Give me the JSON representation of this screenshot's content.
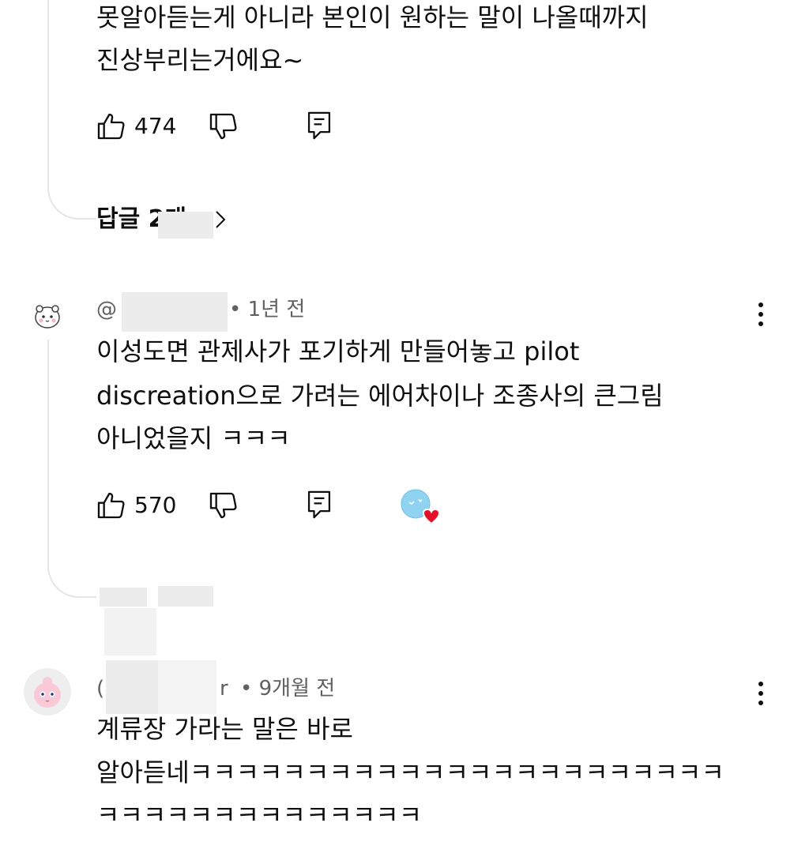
{
  "comment0": {
    "text_lines": [
      "못알아듣는게 아니라 본인이 원하는 말이 나올때까지",
      "진상부리는거에요~"
    ],
    "likes": "474",
    "replies_label": "답글 2개",
    "icons": [
      "like-icon",
      "dislike-icon",
      "reply-icon",
      "chevron-right-icon"
    ]
  },
  "comment1": {
    "handle_prefix": "@",
    "time": "• 1년 전",
    "text_lines": [
      "이성도면 관제사가 포기하게 만들어놓고 pilot",
      "discreation으로 가려는 에어차이나 조종사의 큰그림",
      "아니었을지 ㅋㅋㅋ"
    ],
    "likes": "570",
    "icons": [
      "like-icon",
      "dislike-icon",
      "reply-icon",
      "creator-heart-icon",
      "more-vert-icon"
    ]
  },
  "comment2": {
    "handle_prefix": "(",
    "handle_suffix": "r",
    "time": "• 9개월 전",
    "text_lines": [
      "계류장 가라는 말은 바로",
      "알아듣네ㅋㅋㅋㅋㅋㅋㅋㅋㅋㅋㅋㅋㅋㅋㅋㅋㅋㅋㅋㅋㅋㅋㅋ",
      "ㅋㅋㅋㅋㅋㅋㅋㅋㅋㅋㅋㅋㅋㅋ"
    ],
    "icons": [
      "more-vert-icon"
    ]
  },
  "colors": {
    "text": "#0f0f0f",
    "meta": "#606060",
    "heart": "#e3102c",
    "thread": "#e5e5e5"
  }
}
